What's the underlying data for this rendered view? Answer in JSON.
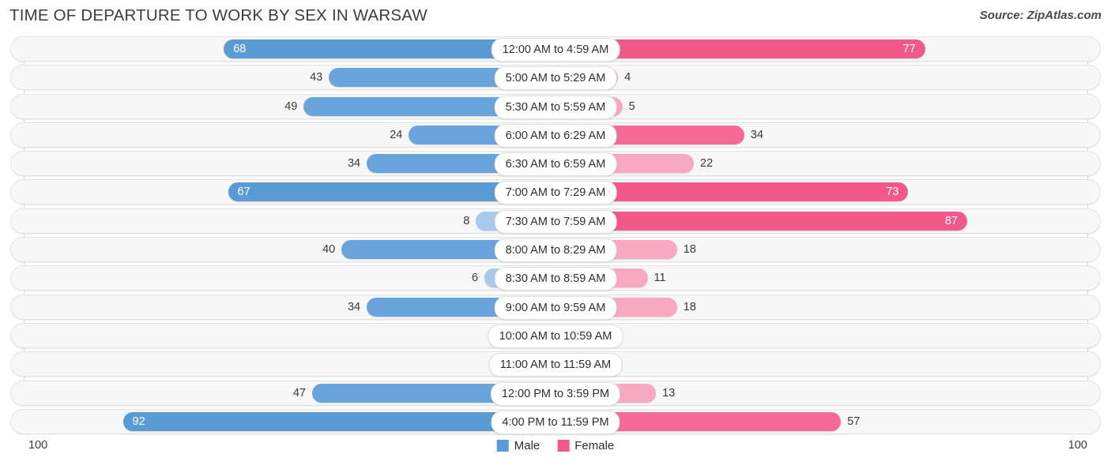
{
  "header": {
    "title": "TIME OF DEPARTURE TO WORK BY SEX IN WARSAW",
    "source": "Source: ZipAtlas.com"
  },
  "legend": {
    "male_label": "Male",
    "female_label": "Female",
    "male_color": "#5b9bd5",
    "female_color": "#f3588a"
  },
  "axis": {
    "left_max": "100",
    "right_max": "100"
  },
  "chart_data": {
    "type": "bar",
    "orientation": "horizontal-diverging",
    "title": "TIME OF DEPARTURE TO WORK BY SEX IN WARSAW",
    "xlabel": "",
    "ylabel": "",
    "xlim": [
      100,
      100
    ],
    "grid": true,
    "legend_position": "bottom-center",
    "categories": [
      "12:00 AM to 4:59 AM",
      "5:00 AM to 5:29 AM",
      "5:30 AM to 5:59 AM",
      "6:00 AM to 6:29 AM",
      "6:30 AM to 6:59 AM",
      "7:00 AM to 7:29 AM",
      "7:30 AM to 7:59 AM",
      "8:00 AM to 8:29 AM",
      "8:30 AM to 8:59 AM",
      "9:00 AM to 9:59 AM",
      "10:00 AM to 10:59 AM",
      "11:00 AM to 11:59 AM",
      "12:00 PM to 3:59 PM",
      "4:00 PM to 11:59 PM"
    ],
    "series": [
      {
        "name": "Male",
        "values": [
          68,
          43,
          49,
          24,
          34,
          67,
          8,
          40,
          6,
          34,
          0,
          0,
          47,
          92
        ]
      },
      {
        "name": "Female",
        "values": [
          77,
          4,
          5,
          34,
          22,
          73,
          87,
          18,
          11,
          18,
          1,
          0,
          13,
          57
        ]
      }
    ]
  },
  "rows": [
    {
      "label": "12:00 AM to 4:59 AM",
      "male": "68",
      "female": "77"
    },
    {
      "label": "5:00 AM to 5:29 AM",
      "male": "43",
      "female": "4"
    },
    {
      "label": "5:30 AM to 5:59 AM",
      "male": "49",
      "female": "5"
    },
    {
      "label": "6:00 AM to 6:29 AM",
      "male": "24",
      "female": "34"
    },
    {
      "label": "6:30 AM to 6:59 AM",
      "male": "34",
      "female": "22"
    },
    {
      "label": "7:00 AM to 7:29 AM",
      "male": "67",
      "female": "73"
    },
    {
      "label": "7:30 AM to 7:59 AM",
      "male": "8",
      "female": "87"
    },
    {
      "label": "8:00 AM to 8:29 AM",
      "male": "40",
      "female": "18"
    },
    {
      "label": "8:30 AM to 8:59 AM",
      "male": "6",
      "female": "11"
    },
    {
      "label": "9:00 AM to 9:59 AM",
      "male": "34",
      "female": "18"
    },
    {
      "label": "10:00 AM to 10:59 AM",
      "male": "0",
      "female": "1"
    },
    {
      "label": "11:00 AM to 11:59 AM",
      "male": "0",
      "female": "0"
    },
    {
      "label": "12:00 PM to 3:59 PM",
      "male": "47",
      "female": "13"
    },
    {
      "label": "4:00 PM to 11:59 PM",
      "male": "92",
      "female": "57"
    }
  ]
}
